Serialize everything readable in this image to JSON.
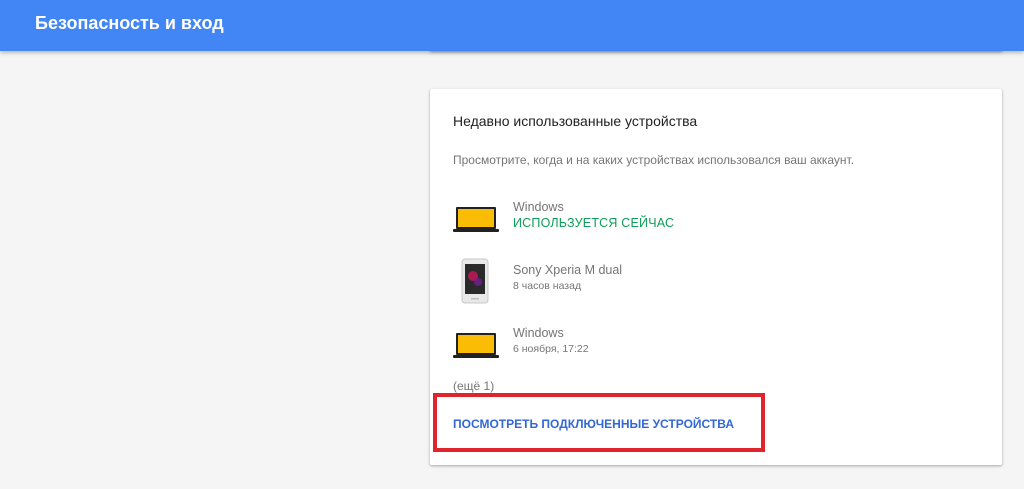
{
  "header": {
    "title": "Безопасность и вход"
  },
  "card": {
    "title": "Недавно использованные устройства",
    "description": "Просмотрите, когда и на каких устройствах использовался ваш аккаунт.",
    "devices": [
      {
        "name": "Windows",
        "status": "ИСПОЛЬЗУЕТСЯ СЕЙЧАС",
        "icon": "laptop-icon"
      },
      {
        "name": "Sony Xperia M dual",
        "time": "8 часов назад",
        "icon": "phone-icon"
      },
      {
        "name": "Windows",
        "time": "6 ноября, 17:22",
        "icon": "laptop-icon"
      }
    ],
    "more": "(ещё 1)",
    "view_link": "ПОСМОТРЕТЬ ПОДКЛЮЧЕННЫЕ УСТРОЙСТВА"
  },
  "colors": {
    "header_bg": "#4285f4",
    "status_green": "#0f9d58",
    "link_blue": "#3367d6",
    "highlight_red": "#e0242c"
  }
}
